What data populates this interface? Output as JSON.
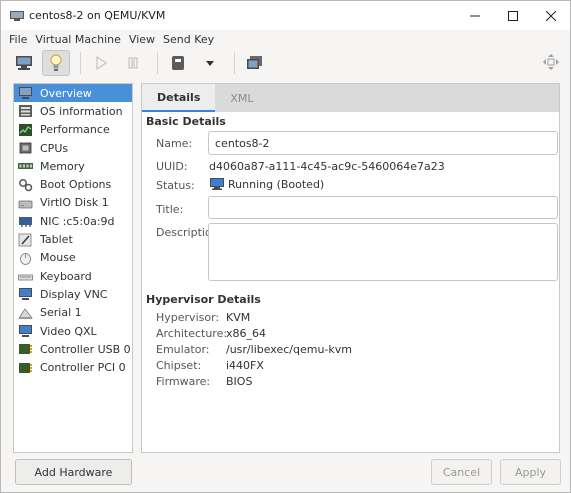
{
  "window": {
    "title": "centos8-2 on QEMU/KVM",
    "controls": [
      "minimize",
      "maximize",
      "close"
    ]
  },
  "menubar": [
    "File",
    "Virtual Machine",
    "View",
    "Send Key"
  ],
  "toolbar": {
    "buttons": [
      "monitor-icon",
      "lightbulb-icon",
      "play-icon",
      "pause-icon",
      "power-icon",
      "dropdown-arrow-icon",
      "snapshot-icon"
    ],
    "right_icon": "fullscreen-icon",
    "active_button": "lightbulb-icon"
  },
  "sidebar": {
    "items": [
      {
        "label": "Overview",
        "icon": "monitor-icon",
        "selected": true
      },
      {
        "label": "OS information",
        "icon": "os-icon"
      },
      {
        "label": "Performance",
        "icon": "performance-icon"
      },
      {
        "label": "CPUs",
        "icon": "cpu-icon"
      },
      {
        "label": "Memory",
        "icon": "memory-icon"
      },
      {
        "label": "Boot Options",
        "icon": "gears-icon"
      },
      {
        "label": "VirtIO Disk 1",
        "icon": "disk-icon"
      },
      {
        "label": "NIC :c5:0a:9d",
        "icon": "nic-icon"
      },
      {
        "label": "Tablet",
        "icon": "tablet-icon"
      },
      {
        "label": "Mouse",
        "icon": "mouse-icon"
      },
      {
        "label": "Keyboard",
        "icon": "keyboard-icon"
      },
      {
        "label": "Display VNC",
        "icon": "display-icon"
      },
      {
        "label": "Serial 1",
        "icon": "serial-icon"
      },
      {
        "label": "Video QXL",
        "icon": "video-icon"
      },
      {
        "label": "Controller USB 0",
        "icon": "controller-icon"
      },
      {
        "label": "Controller PCI 0",
        "icon": "controller-icon"
      }
    ],
    "add_hardware": "Add Hardware"
  },
  "tabs": [
    {
      "label": "Details",
      "active": true
    },
    {
      "label": "XML",
      "active": false
    }
  ],
  "basic": {
    "heading": "Basic Details",
    "name_label": "Name:",
    "name_value": "centos8-2",
    "uuid_label": "UUID:",
    "uuid_value": "d4060a87-a111-4c45-ac9c-5460064e7a23",
    "status_label": "Status:",
    "status_value": "Running (Booted)",
    "title_label": "Title:",
    "title_value": "",
    "description_label": "Description:",
    "description_value": ""
  },
  "hypervisor": {
    "heading": "Hypervisor Details",
    "rows": [
      {
        "label": "Hypervisor:",
        "value": "KVM"
      },
      {
        "label": "Architecture:",
        "value": "x86_64"
      },
      {
        "label": "Emulator:",
        "value": "/usr/libexec/qemu-kvm"
      },
      {
        "label": "Chipset:",
        "value": "i440FX"
      },
      {
        "label": "Firmware:",
        "value": "BIOS"
      }
    ]
  },
  "buttons": {
    "cancel": "Cancel",
    "apply": "Apply"
  },
  "colors": {
    "selection": "#4a90d9",
    "tab_underline": "#3584e4",
    "tab_bar": "#dadada"
  }
}
